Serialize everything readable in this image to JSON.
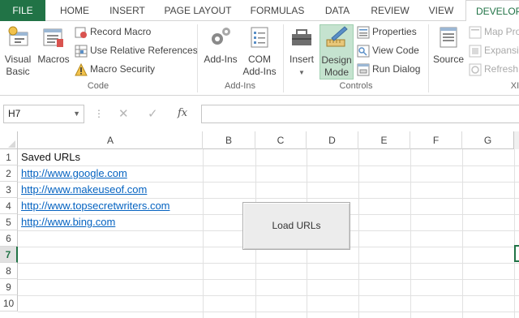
{
  "ribbon_tabs": {
    "file": "FILE",
    "home": "HOME",
    "insert": "INSERT",
    "page_layout": "PAGE LAYOUT",
    "formulas": "FORMULAS",
    "data": "DATA",
    "review": "REVIEW",
    "view": "VIEW",
    "developer": "DEVELOPER"
  },
  "code_group": {
    "label": "Code",
    "visual_basic": "Visual Basic",
    "visual_basic_line1": "Visual",
    "visual_basic_line2": "Basic",
    "macros": "Macros",
    "record_macro": "Record Macro",
    "relative_refs": "Use Relative References",
    "macro_security": "Macro Security"
  },
  "addins_group": {
    "label": "Add-Ins",
    "addins": "Add-Ins",
    "com_line1": "COM",
    "com_line2": "Add-Ins"
  },
  "controls_group": {
    "label": "Controls",
    "insert": "Insert",
    "design_line1": "Design",
    "design_line2": "Mode",
    "properties": "Properties",
    "view_code": "View Code",
    "run_dialog": "Run Dialog"
  },
  "xml_group": {
    "label": "XI",
    "source": "Source",
    "map_properties": "Map Pro",
    "expansion_packs": "Expansic",
    "refresh_data": "Refresh I"
  },
  "formula_bar": {
    "name_box": "H7",
    "formula": "",
    "fx_label": "fx"
  },
  "columns": [
    "A",
    "B",
    "C",
    "D",
    "E",
    "F",
    "G"
  ],
  "rows": [
    "1",
    "2",
    "3",
    "4",
    "5",
    "6",
    "7",
    "8",
    "9",
    "10"
  ],
  "cells": {
    "a1": "Saved URLs",
    "a2": "http://www.google.com",
    "a3": "http://www.makeuseof.com",
    "a4": "http://www.topsecretwriters.com",
    "a5": "http://www.bing.com"
  },
  "form_button": {
    "label": "Load URLs"
  },
  "colors": {
    "accent": "#217346",
    "link": "#0563c1"
  }
}
